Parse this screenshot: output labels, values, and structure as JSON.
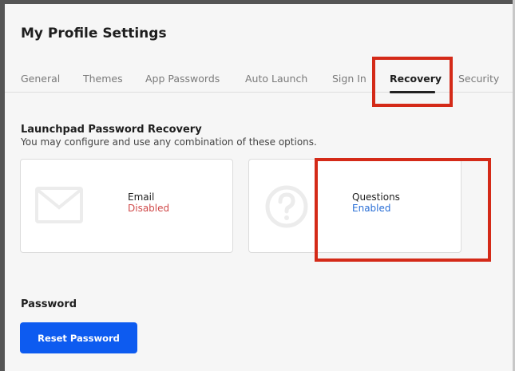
{
  "header": {
    "title": "My Profile Settings"
  },
  "tabs": [
    {
      "label": "General"
    },
    {
      "label": "Themes"
    },
    {
      "label": "App Passwords"
    },
    {
      "label": "Auto Launch"
    },
    {
      "label": "Sign In"
    },
    {
      "label": "Recovery",
      "active": true
    },
    {
      "label": "Security"
    }
  ],
  "recovery": {
    "title": "Launchpad Password Recovery",
    "description": "You may configure and use any combination of these options.",
    "options": [
      {
        "label": "Email",
        "status": "Disabled",
        "icon": "envelope-icon",
        "status_color": "#d04a4a"
      },
      {
        "label": "Questions",
        "status": "Enabled",
        "icon": "question-circle-icon",
        "status_color": "#2a6fd6"
      }
    ]
  },
  "password": {
    "title": "Password",
    "reset_label": "Reset Password"
  },
  "colors": {
    "primary_button": "#0d5bf0",
    "annotation_red": "#d42a18"
  }
}
